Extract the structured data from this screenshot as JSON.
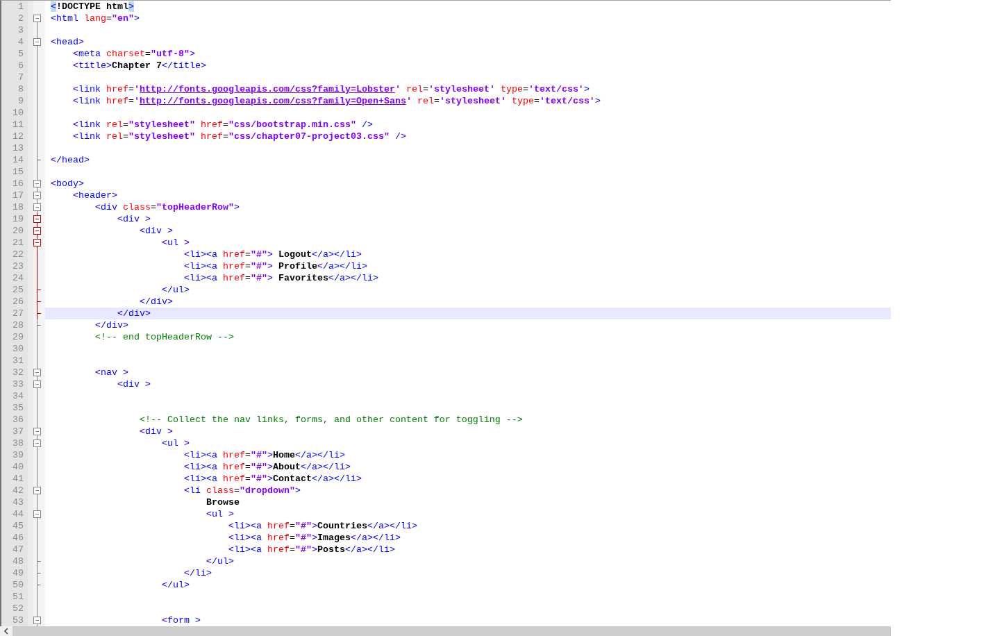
{
  "lines": [
    {
      "number": "1",
      "current": false,
      "segments": [
        {
          "kind": "brace",
          "text": "<"
        },
        {
          "kind": "text",
          "text": "!DOCTYPE html"
        },
        {
          "kind": "brace",
          "text": ">"
        }
      ]
    },
    {
      "number": "2",
      "fold": {
        "kind": "box",
        "active": false
      },
      "current": false,
      "segments": [
        {
          "kind": "tag",
          "text": "<html "
        },
        {
          "kind": "attr",
          "text": "lang"
        },
        {
          "kind": "op",
          "text": "="
        },
        {
          "kind": "str",
          "text": "\"en\""
        },
        {
          "kind": "tag",
          "text": ">"
        }
      ]
    },
    {
      "number": "3",
      "fold": {
        "kind": "line",
        "active": false
      },
      "current": false
    },
    {
      "number": "4",
      "fold": {
        "kind": "box",
        "active": false
      },
      "current": false,
      "segments": [
        {
          "kind": "tag",
          "text": "<head>"
        }
      ]
    },
    {
      "number": "5",
      "fold": {
        "kind": "line",
        "active": false
      },
      "current": false,
      "segments": [
        {
          "kind": "tag",
          "text": "    <meta "
        },
        {
          "kind": "attr",
          "text": "charset"
        },
        {
          "kind": "op",
          "text": "="
        },
        {
          "kind": "str",
          "text": "\"utf-8\""
        },
        {
          "kind": "tag",
          "text": ">"
        }
      ]
    },
    {
      "number": "6",
      "fold": {
        "kind": "line",
        "active": false
      },
      "current": false,
      "segments": [
        {
          "kind": "tag",
          "text": "    <title>"
        },
        {
          "kind": "text",
          "text": "Chapter 7"
        },
        {
          "kind": "tag",
          "text": "</title>"
        }
      ]
    },
    {
      "number": "7",
      "fold": {
        "kind": "line",
        "active": false
      },
      "current": false
    },
    {
      "number": "8",
      "fold": {
        "kind": "line",
        "active": false
      },
      "current": false,
      "segments": [
        {
          "kind": "tag",
          "text": "    <link "
        },
        {
          "kind": "attr",
          "text": "href"
        },
        {
          "kind": "op",
          "text": "="
        },
        {
          "kind": "str",
          "text": "'"
        },
        {
          "kind": "url",
          "text": "http://fonts.googleapis.com/css?family=Lobster"
        },
        {
          "kind": "str",
          "text": "' "
        },
        {
          "kind": "attr",
          "text": "rel"
        },
        {
          "kind": "op",
          "text": "="
        },
        {
          "kind": "str",
          "text": "'stylesheet' "
        },
        {
          "kind": "attr",
          "text": "type"
        },
        {
          "kind": "op",
          "text": "="
        },
        {
          "kind": "str",
          "text": "'text/css'"
        },
        {
          "kind": "tag",
          "text": ">"
        }
      ]
    },
    {
      "number": "9",
      "fold": {
        "kind": "line",
        "active": false
      },
      "current": false,
      "segments": [
        {
          "kind": "tag",
          "text": "    <link "
        },
        {
          "kind": "attr",
          "text": "href"
        },
        {
          "kind": "op",
          "text": "="
        },
        {
          "kind": "str",
          "text": "'"
        },
        {
          "kind": "url",
          "text": "http://fonts.googleapis.com/css?family=Open+Sans"
        },
        {
          "kind": "str",
          "text": "' "
        },
        {
          "kind": "attr",
          "text": "rel"
        },
        {
          "kind": "op",
          "text": "="
        },
        {
          "kind": "str",
          "text": "'stylesheet' "
        },
        {
          "kind": "attr",
          "text": "type"
        },
        {
          "kind": "op",
          "text": "="
        },
        {
          "kind": "str",
          "text": "'text/css'"
        },
        {
          "kind": "tag",
          "text": ">"
        }
      ]
    },
    {
      "number": "10",
      "fold": {
        "kind": "line",
        "active": false
      },
      "current": false
    },
    {
      "number": "11",
      "fold": {
        "kind": "line",
        "active": false
      },
      "current": false,
      "segments": [
        {
          "kind": "tag",
          "text": "    <link "
        },
        {
          "kind": "attr",
          "text": "rel"
        },
        {
          "kind": "op",
          "text": "="
        },
        {
          "kind": "str",
          "text": "\"stylesheet\" "
        },
        {
          "kind": "attr",
          "text": "href"
        },
        {
          "kind": "op",
          "text": "="
        },
        {
          "kind": "str",
          "text": "\"css/bootstrap.min.css\" "
        },
        {
          "kind": "tag",
          "text": "/>"
        }
      ]
    },
    {
      "number": "12",
      "fold": {
        "kind": "line",
        "active": false
      },
      "current": false,
      "segments": [
        {
          "kind": "tag",
          "text": "    <link "
        },
        {
          "kind": "attr",
          "text": "rel"
        },
        {
          "kind": "op",
          "text": "="
        },
        {
          "kind": "str",
          "text": "\"stylesheet\" "
        },
        {
          "kind": "attr",
          "text": "href"
        },
        {
          "kind": "op",
          "text": "="
        },
        {
          "kind": "str",
          "text": "\"css/chapter07-project03.css\" "
        },
        {
          "kind": "tag",
          "text": "/>"
        }
      ]
    },
    {
      "number": "13",
      "fold": {
        "kind": "line",
        "active": false
      },
      "current": false
    },
    {
      "number": "14",
      "fold": {
        "kind": "end",
        "active": false
      },
      "current": false,
      "segments": [
        {
          "kind": "tag",
          "text": "</head>"
        }
      ]
    },
    {
      "number": "15",
      "fold": {
        "kind": "line",
        "active": false
      },
      "current": false
    },
    {
      "number": "16",
      "fold": {
        "kind": "box",
        "active": false
      },
      "current": false,
      "segments": [
        {
          "kind": "tag",
          "text": "<body>"
        }
      ]
    },
    {
      "number": "17",
      "fold": {
        "kind": "box",
        "active": false
      },
      "current": false,
      "segments": [
        {
          "kind": "tag",
          "text": "    <header>"
        }
      ]
    },
    {
      "number": "18",
      "fold": {
        "kind": "box",
        "active": false
      },
      "current": false,
      "segments": [
        {
          "kind": "tag",
          "text": "        <div "
        },
        {
          "kind": "attr",
          "text": "class"
        },
        {
          "kind": "op",
          "text": "="
        },
        {
          "kind": "str",
          "text": "\"topHeaderRow\""
        },
        {
          "kind": "tag",
          "text": ">"
        }
      ]
    },
    {
      "number": "19",
      "fold": {
        "kind": "box",
        "active": true
      },
      "current": false,
      "segments": [
        {
          "kind": "tag",
          "text": "            <div >"
        }
      ]
    },
    {
      "number": "20",
      "fold": {
        "kind": "box",
        "active": true
      },
      "current": false,
      "segments": [
        {
          "kind": "tag",
          "text": "                <div >"
        }
      ]
    },
    {
      "number": "21",
      "fold": {
        "kind": "box",
        "active": true
      },
      "current": false,
      "segments": [
        {
          "kind": "tag",
          "text": "                    <ul >"
        }
      ]
    },
    {
      "number": "22",
      "fold": {
        "kind": "line",
        "active": true
      },
      "current": false,
      "segments": [
        {
          "kind": "tag",
          "text": "                        <li><a "
        },
        {
          "kind": "attr",
          "text": "href"
        },
        {
          "kind": "op",
          "text": "="
        },
        {
          "kind": "str",
          "text": "\"#\""
        },
        {
          "kind": "tag",
          "text": ">"
        },
        {
          "kind": "text",
          "text": " Logout"
        },
        {
          "kind": "tag",
          "text": "</a></li>"
        }
      ]
    },
    {
      "number": "23",
      "fold": {
        "kind": "line",
        "active": true
      },
      "current": false,
      "segments": [
        {
          "kind": "tag",
          "text": "                        <li><a "
        },
        {
          "kind": "attr",
          "text": "href"
        },
        {
          "kind": "op",
          "text": "="
        },
        {
          "kind": "str",
          "text": "\"#\""
        },
        {
          "kind": "tag",
          "text": ">"
        },
        {
          "kind": "text",
          "text": " Profile"
        },
        {
          "kind": "tag",
          "text": "</a></li>"
        }
      ]
    },
    {
      "number": "24",
      "fold": {
        "kind": "line",
        "active": true
      },
      "current": false,
      "segments": [
        {
          "kind": "tag",
          "text": "                        <li><a "
        },
        {
          "kind": "attr",
          "text": "href"
        },
        {
          "kind": "op",
          "text": "="
        },
        {
          "kind": "str",
          "text": "\"#\""
        },
        {
          "kind": "tag",
          "text": ">"
        },
        {
          "kind": "text",
          "text": " Favorites"
        },
        {
          "kind": "tag",
          "text": "</a></li>"
        }
      ]
    },
    {
      "number": "25",
      "fold": {
        "kind": "end",
        "active": true
      },
      "current": false,
      "segments": [
        {
          "kind": "tag",
          "text": "                    </ul>"
        }
      ]
    },
    {
      "number": "26",
      "fold": {
        "kind": "end",
        "active": true
      },
      "current": false,
      "segments": [
        {
          "kind": "tag",
          "text": "                </div>"
        }
      ]
    },
    {
      "number": "27",
      "fold": {
        "kind": "end",
        "active": true
      },
      "current": true,
      "segments": [
        {
          "kind": "tag",
          "text": "            </div>"
        }
      ]
    },
    {
      "number": "28",
      "fold": {
        "kind": "end",
        "active": false
      },
      "current": false,
      "segments": [
        {
          "kind": "tag",
          "text": "        </div>"
        }
      ]
    },
    {
      "number": "29",
      "fold": {
        "kind": "line",
        "active": false
      },
      "current": false,
      "segments": [
        {
          "kind": "comment",
          "text": "        <!-- end topHeaderRow -->"
        }
      ]
    },
    {
      "number": "30",
      "fold": {
        "kind": "line",
        "active": false
      },
      "current": false
    },
    {
      "number": "31",
      "fold": {
        "kind": "line",
        "active": false
      },
      "current": false
    },
    {
      "number": "32",
      "fold": {
        "kind": "box",
        "active": false
      },
      "current": false,
      "segments": [
        {
          "kind": "tag",
          "text": "        <nav >"
        }
      ]
    },
    {
      "number": "33",
      "fold": {
        "kind": "box",
        "active": false
      },
      "current": false,
      "segments": [
        {
          "kind": "tag",
          "text": "            <div >"
        }
      ]
    },
    {
      "number": "34",
      "fold": {
        "kind": "line",
        "active": false
      },
      "current": false
    },
    {
      "number": "35",
      "fold": {
        "kind": "line",
        "active": false
      },
      "current": false
    },
    {
      "number": "36",
      "fold": {
        "kind": "line",
        "active": false
      },
      "current": false,
      "segments": [
        {
          "kind": "comment",
          "text": "                <!-- Collect the nav links, forms, and other content for toggling -->"
        }
      ]
    },
    {
      "number": "37",
      "fold": {
        "kind": "box",
        "active": false
      },
      "current": false,
      "segments": [
        {
          "kind": "tag",
          "text": "                <div >"
        }
      ]
    },
    {
      "number": "38",
      "fold": {
        "kind": "box",
        "active": false
      },
      "current": false,
      "segments": [
        {
          "kind": "tag",
          "text": "                    <ul >"
        }
      ]
    },
    {
      "number": "39",
      "fold": {
        "kind": "line",
        "active": false
      },
      "current": false,
      "segments": [
        {
          "kind": "tag",
          "text": "                        <li><a "
        },
        {
          "kind": "attr",
          "text": "href"
        },
        {
          "kind": "op",
          "text": "="
        },
        {
          "kind": "str",
          "text": "\"#\""
        },
        {
          "kind": "tag",
          "text": ">"
        },
        {
          "kind": "text",
          "text": "Home"
        },
        {
          "kind": "tag",
          "text": "</a></li>"
        }
      ]
    },
    {
      "number": "40",
      "fold": {
        "kind": "line",
        "active": false
      },
      "current": false,
      "segments": [
        {
          "kind": "tag",
          "text": "                        <li><a "
        },
        {
          "kind": "attr",
          "text": "href"
        },
        {
          "kind": "op",
          "text": "="
        },
        {
          "kind": "str",
          "text": "\"#\""
        },
        {
          "kind": "tag",
          "text": ">"
        },
        {
          "kind": "text",
          "text": "About"
        },
        {
          "kind": "tag",
          "text": "</a></li>"
        }
      ]
    },
    {
      "number": "41",
      "fold": {
        "kind": "line",
        "active": false
      },
      "current": false,
      "segments": [
        {
          "kind": "tag",
          "text": "                        <li><a "
        },
        {
          "kind": "attr",
          "text": "href"
        },
        {
          "kind": "op",
          "text": "="
        },
        {
          "kind": "str",
          "text": "\"#\""
        },
        {
          "kind": "tag",
          "text": ">"
        },
        {
          "kind": "text",
          "text": "Contact"
        },
        {
          "kind": "tag",
          "text": "</a></li>"
        }
      ]
    },
    {
      "number": "42",
      "fold": {
        "kind": "box",
        "active": false
      },
      "current": false,
      "segments": [
        {
          "kind": "tag",
          "text": "                        <li "
        },
        {
          "kind": "attr",
          "text": "class"
        },
        {
          "kind": "op",
          "text": "="
        },
        {
          "kind": "str",
          "text": "\"dropdown\""
        },
        {
          "kind": "tag",
          "text": ">"
        }
      ]
    },
    {
      "number": "43",
      "fold": {
        "kind": "line",
        "active": false
      },
      "current": false,
      "segments": [
        {
          "kind": "text",
          "text": "                            Browse"
        }
      ]
    },
    {
      "number": "44",
      "fold": {
        "kind": "box",
        "active": false
      },
      "current": false,
      "segments": [
        {
          "kind": "tag",
          "text": "                            <ul >"
        }
      ]
    },
    {
      "number": "45",
      "fold": {
        "kind": "line",
        "active": false
      },
      "current": false,
      "segments": [
        {
          "kind": "tag",
          "text": "                                <li><a "
        },
        {
          "kind": "attr",
          "text": "href"
        },
        {
          "kind": "op",
          "text": "="
        },
        {
          "kind": "str",
          "text": "\"#\""
        },
        {
          "kind": "tag",
          "text": ">"
        },
        {
          "kind": "text",
          "text": "Countries"
        },
        {
          "kind": "tag",
          "text": "</a></li>"
        }
      ]
    },
    {
      "number": "46",
      "fold": {
        "kind": "line",
        "active": false
      },
      "current": false,
      "segments": [
        {
          "kind": "tag",
          "text": "                                <li><a "
        },
        {
          "kind": "attr",
          "text": "href"
        },
        {
          "kind": "op",
          "text": "="
        },
        {
          "kind": "str",
          "text": "\"#\""
        },
        {
          "kind": "tag",
          "text": ">"
        },
        {
          "kind": "text",
          "text": "Images"
        },
        {
          "kind": "tag",
          "text": "</a></li>"
        }
      ]
    },
    {
      "number": "47",
      "fold": {
        "kind": "line",
        "active": false
      },
      "current": false,
      "segments": [
        {
          "kind": "tag",
          "text": "                                <li><a "
        },
        {
          "kind": "attr",
          "text": "href"
        },
        {
          "kind": "op",
          "text": "="
        },
        {
          "kind": "str",
          "text": "\"#\""
        },
        {
          "kind": "tag",
          "text": ">"
        },
        {
          "kind": "text",
          "text": "Posts"
        },
        {
          "kind": "tag",
          "text": "</a></li>"
        }
      ]
    },
    {
      "number": "48",
      "fold": {
        "kind": "end",
        "active": false
      },
      "current": false,
      "segments": [
        {
          "kind": "tag",
          "text": "                            </ul>"
        }
      ]
    },
    {
      "number": "49",
      "fold": {
        "kind": "end",
        "active": false
      },
      "current": false,
      "segments": [
        {
          "kind": "tag",
          "text": "                        </li>"
        }
      ]
    },
    {
      "number": "50",
      "fold": {
        "kind": "end",
        "active": false
      },
      "current": false,
      "segments": [
        {
          "kind": "tag",
          "text": "                    </ul>"
        }
      ]
    },
    {
      "number": "51",
      "fold": {
        "kind": "line",
        "active": false
      },
      "current": false
    },
    {
      "number": "52",
      "fold": {
        "kind": "line",
        "active": false
      },
      "current": false
    },
    {
      "number": "53",
      "fold": {
        "kind": "box",
        "active": false
      },
      "current": false,
      "segments": [
        {
          "kind": "tag",
          "text": "                    <form >"
        }
      ]
    }
  ]
}
